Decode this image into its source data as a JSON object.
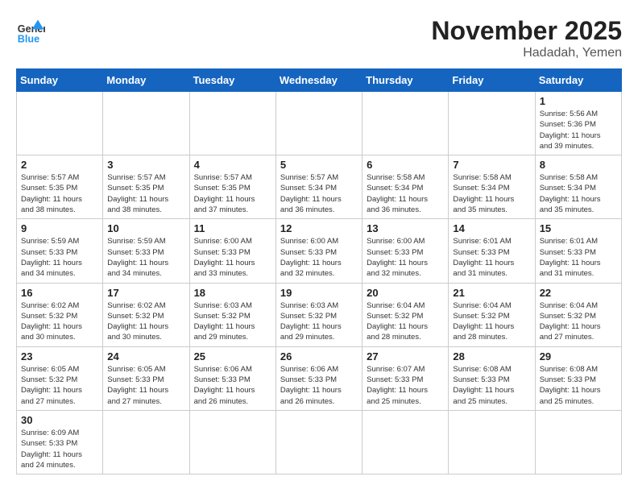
{
  "header": {
    "logo_general": "General",
    "logo_blue": "Blue",
    "month_title": "November 2025",
    "location": "Hadadah, Yemen"
  },
  "days_of_week": [
    "Sunday",
    "Monday",
    "Tuesday",
    "Wednesday",
    "Thursday",
    "Friday",
    "Saturday"
  ],
  "weeks": [
    [
      {
        "day": "",
        "info": ""
      },
      {
        "day": "",
        "info": ""
      },
      {
        "day": "",
        "info": ""
      },
      {
        "day": "",
        "info": ""
      },
      {
        "day": "",
        "info": ""
      },
      {
        "day": "",
        "info": ""
      },
      {
        "day": "1",
        "info": "Sunrise: 5:56 AM\nSunset: 5:36 PM\nDaylight: 11 hours\nand 39 minutes."
      }
    ],
    [
      {
        "day": "2",
        "info": "Sunrise: 5:57 AM\nSunset: 5:35 PM\nDaylight: 11 hours\nand 38 minutes."
      },
      {
        "day": "3",
        "info": "Sunrise: 5:57 AM\nSunset: 5:35 PM\nDaylight: 11 hours\nand 38 minutes."
      },
      {
        "day": "4",
        "info": "Sunrise: 5:57 AM\nSunset: 5:35 PM\nDaylight: 11 hours\nand 37 minutes."
      },
      {
        "day": "5",
        "info": "Sunrise: 5:57 AM\nSunset: 5:34 PM\nDaylight: 11 hours\nand 36 minutes."
      },
      {
        "day": "6",
        "info": "Sunrise: 5:58 AM\nSunset: 5:34 PM\nDaylight: 11 hours\nand 36 minutes."
      },
      {
        "day": "7",
        "info": "Sunrise: 5:58 AM\nSunset: 5:34 PM\nDaylight: 11 hours\nand 35 minutes."
      },
      {
        "day": "8",
        "info": "Sunrise: 5:58 AM\nSunset: 5:34 PM\nDaylight: 11 hours\nand 35 minutes."
      }
    ],
    [
      {
        "day": "9",
        "info": "Sunrise: 5:59 AM\nSunset: 5:33 PM\nDaylight: 11 hours\nand 34 minutes."
      },
      {
        "day": "10",
        "info": "Sunrise: 5:59 AM\nSunset: 5:33 PM\nDaylight: 11 hours\nand 34 minutes."
      },
      {
        "day": "11",
        "info": "Sunrise: 6:00 AM\nSunset: 5:33 PM\nDaylight: 11 hours\nand 33 minutes."
      },
      {
        "day": "12",
        "info": "Sunrise: 6:00 AM\nSunset: 5:33 PM\nDaylight: 11 hours\nand 32 minutes."
      },
      {
        "day": "13",
        "info": "Sunrise: 6:00 AM\nSunset: 5:33 PM\nDaylight: 11 hours\nand 32 minutes."
      },
      {
        "day": "14",
        "info": "Sunrise: 6:01 AM\nSunset: 5:33 PM\nDaylight: 11 hours\nand 31 minutes."
      },
      {
        "day": "15",
        "info": "Sunrise: 6:01 AM\nSunset: 5:33 PM\nDaylight: 11 hours\nand 31 minutes."
      }
    ],
    [
      {
        "day": "16",
        "info": "Sunrise: 6:02 AM\nSunset: 5:32 PM\nDaylight: 11 hours\nand 30 minutes."
      },
      {
        "day": "17",
        "info": "Sunrise: 6:02 AM\nSunset: 5:32 PM\nDaylight: 11 hours\nand 30 minutes."
      },
      {
        "day": "18",
        "info": "Sunrise: 6:03 AM\nSunset: 5:32 PM\nDaylight: 11 hours\nand 29 minutes."
      },
      {
        "day": "19",
        "info": "Sunrise: 6:03 AM\nSunset: 5:32 PM\nDaylight: 11 hours\nand 29 minutes."
      },
      {
        "day": "20",
        "info": "Sunrise: 6:04 AM\nSunset: 5:32 PM\nDaylight: 11 hours\nand 28 minutes."
      },
      {
        "day": "21",
        "info": "Sunrise: 6:04 AM\nSunset: 5:32 PM\nDaylight: 11 hours\nand 28 minutes."
      },
      {
        "day": "22",
        "info": "Sunrise: 6:04 AM\nSunset: 5:32 PM\nDaylight: 11 hours\nand 27 minutes."
      }
    ],
    [
      {
        "day": "23",
        "info": "Sunrise: 6:05 AM\nSunset: 5:32 PM\nDaylight: 11 hours\nand 27 minutes."
      },
      {
        "day": "24",
        "info": "Sunrise: 6:05 AM\nSunset: 5:33 PM\nDaylight: 11 hours\nand 27 minutes."
      },
      {
        "day": "25",
        "info": "Sunrise: 6:06 AM\nSunset: 5:33 PM\nDaylight: 11 hours\nand 26 minutes."
      },
      {
        "day": "26",
        "info": "Sunrise: 6:06 AM\nSunset: 5:33 PM\nDaylight: 11 hours\nand 26 minutes."
      },
      {
        "day": "27",
        "info": "Sunrise: 6:07 AM\nSunset: 5:33 PM\nDaylight: 11 hours\nand 25 minutes."
      },
      {
        "day": "28",
        "info": "Sunrise: 6:08 AM\nSunset: 5:33 PM\nDaylight: 11 hours\nand 25 minutes."
      },
      {
        "day": "29",
        "info": "Sunrise: 6:08 AM\nSunset: 5:33 PM\nDaylight: 11 hours\nand 25 minutes."
      }
    ],
    [
      {
        "day": "30",
        "info": "Sunrise: 6:09 AM\nSunset: 5:33 PM\nDaylight: 11 hours\nand 24 minutes."
      },
      {
        "day": "",
        "info": ""
      },
      {
        "day": "",
        "info": ""
      },
      {
        "day": "",
        "info": ""
      },
      {
        "day": "",
        "info": ""
      },
      {
        "day": "",
        "info": ""
      },
      {
        "day": "",
        "info": ""
      }
    ]
  ]
}
